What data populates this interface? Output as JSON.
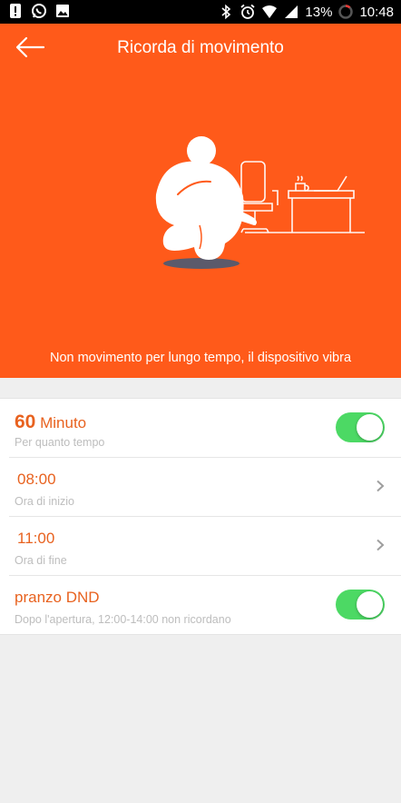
{
  "status_bar": {
    "battery": "13%",
    "time": "10:48"
  },
  "header": {
    "title": "Ricorda di movimento"
  },
  "hero": {
    "caption": "Non movimento per lungo tempo, il dispositivo vibra"
  },
  "settings": {
    "duration": {
      "value": "60",
      "unit": "Minuto",
      "sub": "Per quanto tempo",
      "enabled": true
    },
    "start": {
      "value": "08:00",
      "sub": "Ora di inizio"
    },
    "end": {
      "value": "11:00",
      "sub": "Ora di fine"
    },
    "lunch_dnd": {
      "label": "pranzo DND",
      "sub": "Dopo l'apertura, 12:00-14:00 non ricordano",
      "enabled": true
    }
  },
  "colors": {
    "accent": "#ff5a1a",
    "toggle_on": "#4cd964",
    "text_accent": "#e8621f"
  }
}
